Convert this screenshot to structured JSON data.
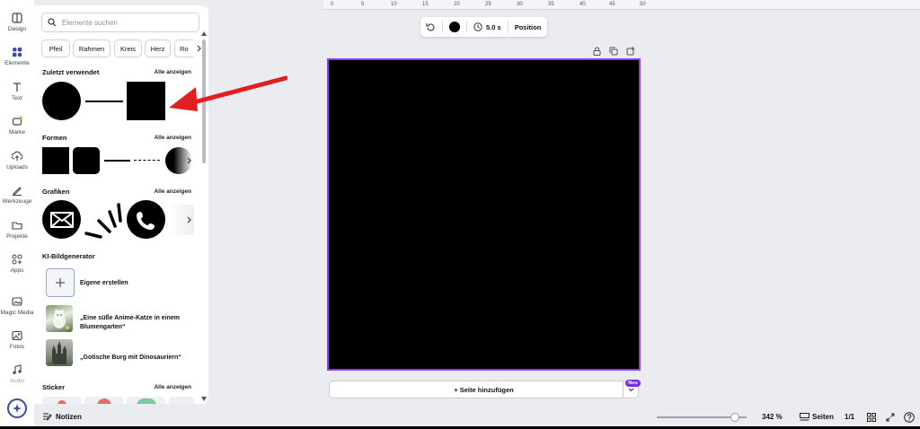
{
  "rail": {
    "items": [
      {
        "label": "Design",
        "icon": "design-icon"
      },
      {
        "label": "Elemente",
        "icon": "elements-icon"
      },
      {
        "label": "Text",
        "icon": "text-icon"
      },
      {
        "label": "Marke",
        "icon": "brand-icon"
      },
      {
        "label": "Uploads",
        "icon": "upload-icon"
      },
      {
        "label": "Werkzeuge",
        "icon": "tools-icon"
      },
      {
        "label": "Projekte",
        "icon": "folder-icon"
      },
      {
        "label": "Apps",
        "icon": "apps-icon"
      },
      {
        "label": "Magic Media",
        "icon": "magic-media-icon"
      },
      {
        "label": "Fotos",
        "icon": "photo-icon"
      },
      {
        "label": "Audio",
        "icon": "audio-icon"
      }
    ]
  },
  "panel": {
    "search_placeholder": "Elemente suchen",
    "chips": [
      "Pfeil",
      "Rahmen",
      "Kreis",
      "Herz",
      "Ro"
    ],
    "see_all": "Alle anzeigen",
    "sections": {
      "recent": "Zuletzt verwendet",
      "shapes": "Formen",
      "graphics": "Grafiken",
      "ai": "KI-Bildgenerator",
      "sticker": "Sticker"
    },
    "ai_items": {
      "create": "Eigene erstellen",
      "item1": "„Eine süße Anime-Katze in einem Blumengarten“",
      "item2": "„Gotische Burg mit Dinosauriern“"
    }
  },
  "ruler": {
    "ticks": [
      "0",
      "5",
      "10",
      "15",
      "20",
      "25",
      "30",
      "35",
      "40",
      "45",
      "50"
    ]
  },
  "toolbar": {
    "duration": "5.0 s",
    "position": "Position"
  },
  "canvas": {
    "fill_color": "#000000",
    "selection_color": "#8b3dff"
  },
  "add_page": {
    "label": "+ Seite hinzufügen",
    "badge": "Neu"
  },
  "bottom": {
    "notes": "Notizen",
    "zoom": "342 %",
    "pages_label": "Seiten",
    "page_count": "1/1",
    "zoom_fraction": 0.87
  },
  "colors": {
    "accent": "#8b3dff",
    "arrow": "#e02020"
  }
}
